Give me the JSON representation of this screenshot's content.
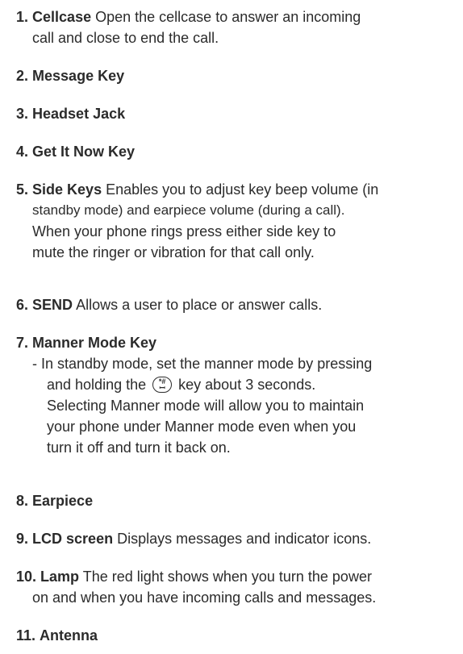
{
  "items": [
    {
      "num": "1.",
      "title": "Cellcase",
      "desc": "Open the cellcase to answer an incoming",
      "cont": "call and close to end the call."
    },
    {
      "num": "2.",
      "title": "Message Key"
    },
    {
      "num": "3.",
      "title": "Headset Jack"
    },
    {
      "num": "4.",
      "title": "Get It Now Key"
    },
    {
      "num": "5.",
      "title": "Side Keys",
      "desc": "Enables you to adjust key beep volume (in",
      "cont1": "standby mode) and earpiece volume (during a call).",
      "cont2": "When your phone rings press either side key to",
      "cont3": "mute the ringer or vibration for that call only."
    },
    {
      "num": "6.",
      "title": "SEND",
      "desc": "Allows a user to place or answer calls."
    },
    {
      "num": "7.",
      "title": "Manner Mode Key",
      "sub1": "- In standby mode, set the manner mode by pressing",
      "sub2a": "and holding the",
      "sub2b": "key about 3 seconds.",
      "sub3": "Selecting Manner mode will allow you to maintain",
      "sub4": "your phone under Manner mode even when you",
      "sub5": "turn it off and turn it back on."
    },
    {
      "num": "8.",
      "title": "Earpiece"
    },
    {
      "num": "9.",
      "title": "LCD  screen",
      "desc": "Displays messages and indicator icons."
    },
    {
      "num": "10.",
      "title": "Lamp",
      "desc": "The red light shows when you turn the power",
      "cont": "on and when you have incoming calls and messages."
    },
    {
      "num": "11.",
      "title": "Antenna"
    }
  ],
  "icons": {
    "manner_key": "manner-mode-key-icon"
  }
}
